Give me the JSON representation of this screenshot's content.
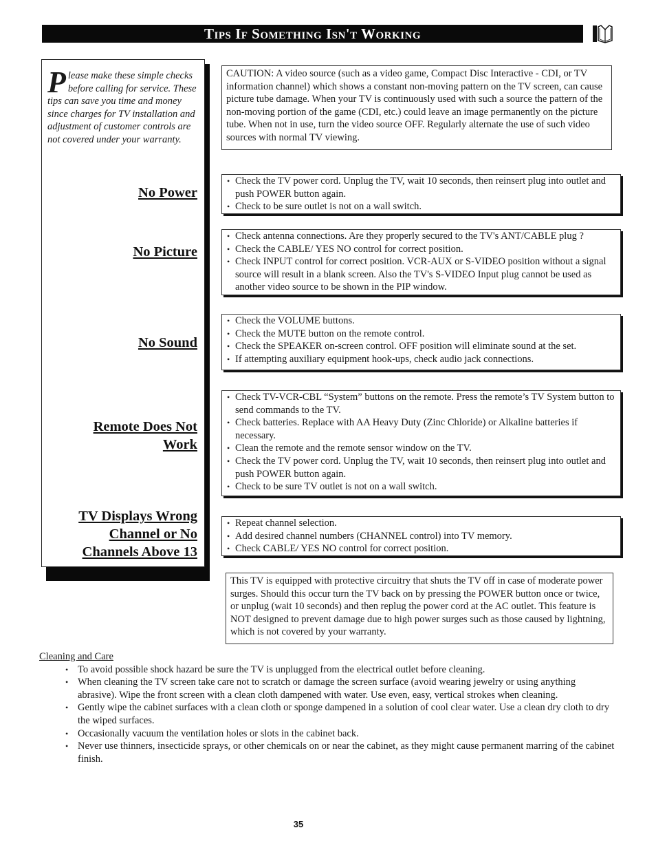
{
  "header": {
    "title": "Tips If Something Isn't Working",
    "icon": "book-icon"
  },
  "sidebar": {
    "intro_dropcap": "P",
    "intro_text": "lease make these simple checks before calling for service. These tips can save you time and money since charges for TV installation and adjustment of customer controls are not covered under your warranty.",
    "headings": [
      {
        "label": "No Power"
      },
      {
        "label": "No Picture"
      },
      {
        "label": "No Sound"
      },
      {
        "label": "Remote Does Not Work"
      },
      {
        "label": "TV Displays Wrong Channel or No Channels Above 13"
      }
    ]
  },
  "caution": {
    "text": "CAUTION: A video source (such as a video game, Compact Disc Interactive - CDI, or TV information channel) which shows a constant non-moving pattern on the TV screen, can cause picture tube damage.  When your TV is continuously used with such a source the pattern of the non-moving portion of the game (CDI, etc.) could leave an image permanently on the picture tube.  When not in use, turn the video source OFF. Regularly alternate the use of such video sources with normal TV viewing."
  },
  "sections": {
    "no_power": [
      "Check the TV power cord.  Unplug the TV, wait 10 seconds, then reinsert plug into outlet and push POWER button again.",
      "Check to be sure outlet is not on a wall switch."
    ],
    "no_picture": [
      "Check antenna connections.  Are they properly secured to the TV's ANT/CABLE plug ?",
      "Check the CABLE/ YES  NO control for correct position.",
      "Check INPUT control for correct position. VCR-AUX or S-VIDEO position without a signal source will result in a blank screen. Also the TV's S-VIDEO Input plug cannot be used as another video source to be shown in the PIP window."
    ],
    "no_sound": [
      "Check the VOLUME buttons.",
      "Check the MUTE button on the remote control.",
      "Check the SPEAKER on-screen control. OFF position will eliminate sound at the set.",
      "If attempting auxiliary equipment hook-ups, check audio jack connections."
    ],
    "remote": [
      "Check TV-VCR-CBL “System” buttons on the remote.  Press the remote’s TV System button to send commands to the TV.",
      "Check batteries.  Replace with AA Heavy Duty (Zinc Chloride) or Alkaline batteries if necessary.",
      "Clean the remote and the remote sensor window on the TV.",
      "Check the TV power cord.  Unplug the TV, wait 10 seconds, then reinsert plug into outlet and push POWER button again.",
      "Check to be sure TV outlet is not on a wall switch."
    ],
    "wrong_channel": [
      "Repeat channel selection.",
      "Add desired channel numbers (CHANNEL control) into TV memory.",
      "Check CABLE/  YES  NO control for correct position."
    ]
  },
  "surge_note": {
    "text": "This TV is equipped with protective circuitry that shuts the TV off in case of moderate power surges.  Should this occur turn the TV back on by pressing the POWER button once or twice, or unplug (wait 10 seconds) and then replug the power cord at the AC outlet. This feature is NOT designed to prevent damage due to high power surges such as those caused by lightning, which is not covered by your warranty."
  },
  "cleaning": {
    "title": "Cleaning and Care",
    "items": [
      "To avoid possible shock hazard be sure the TV is unplugged from the electrical outlet before cleaning.",
      "When cleaning the TV screen take care not to scratch or damage the screen surface (avoid wearing jewelry or using anything abrasive).  Wipe the front screen with a clean cloth dampened with water.  Use even, easy, vertical strokes when cleaning.",
      "Gently wipe the cabinet surfaces with a clean cloth or sponge dampened in a solution of cool clear water.  Use a clean dry cloth to dry the wiped surfaces.",
      "Occasionally vacuum the ventilation holes or slots in the cabinet back.",
      "Never use thinners, insecticide sprays, or other chemicals on or near the cabinet, as they might cause permanent marring of the cabinet finish."
    ]
  },
  "footer": {
    "page_number": "35"
  }
}
